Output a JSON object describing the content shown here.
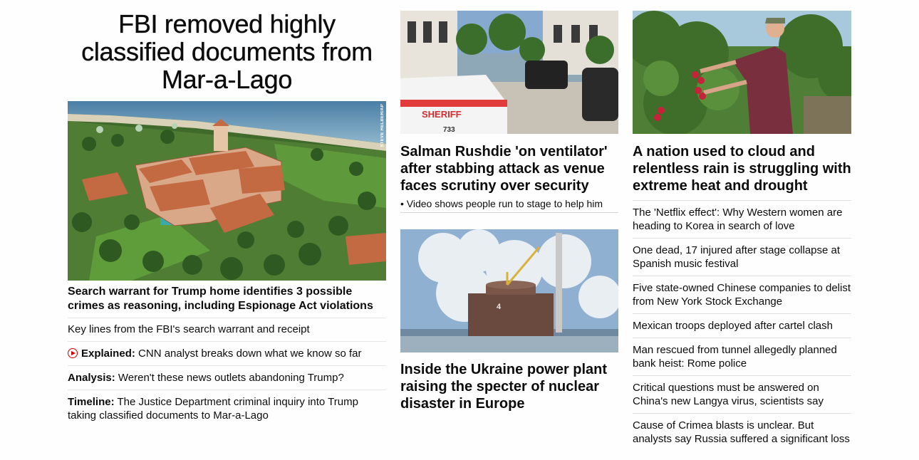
{
  "lead": {
    "headline": "FBI removed highly classified documents from Mar-a-Lago",
    "photo_credit": "STEVE HELBER/AP",
    "title": "Search warrant for Trump home identifies 3 possible crimes as reasoning, including Espionage Act violations",
    "items": [
      {
        "kicker": "",
        "text": "Key lines from the FBI's search warrant and receipt"
      },
      {
        "kicker": "Explained:",
        "text": "CNN analyst breaks down what we know so far"
      },
      {
        "kicker": "Analysis:",
        "text": "Weren't these news outlets abandoning Trump?"
      },
      {
        "kicker": "Timeline:",
        "text": "The Justice Department criminal inquiry into Trump taking classified documents to Mar-a-Lago"
      }
    ]
  },
  "middle": {
    "card1": {
      "title": "Salman Rushdie 'on ventilator' after stabbing attack as venue faces scrutiny over security",
      "sub": "• Video shows people run to stage to help him",
      "car_label": "SHERIFF",
      "car_number": "733"
    },
    "card2": {
      "title": "Inside the Ukraine power plant raising the specter of nuclear disaster in Europe",
      "unit_number": "4"
    }
  },
  "right": {
    "card": {
      "title": "A nation used to cloud and relentless rain is struggling with extreme heat and drought"
    },
    "items": [
      "The 'Netflix effect': Why Western women are heading to Korea in search of love",
      "One dead, 17 injured after stage collapse at Spanish music festival",
      "Five state-owned Chinese companies to delist from New York Stock Exchange",
      "Mexican troops deployed after cartel clash",
      "Man rescued from tunnel allegedly planned bank heist: Rome police",
      "Critical questions must be answered on China's new Langya virus, scientists say",
      "Cause of Crimea blasts is unclear. But analysts say Russia suffered a significant loss"
    ]
  },
  "colors": {
    "accent": "#cc0000",
    "text": "#0c0c0c",
    "divider": "#e0e0e0"
  }
}
